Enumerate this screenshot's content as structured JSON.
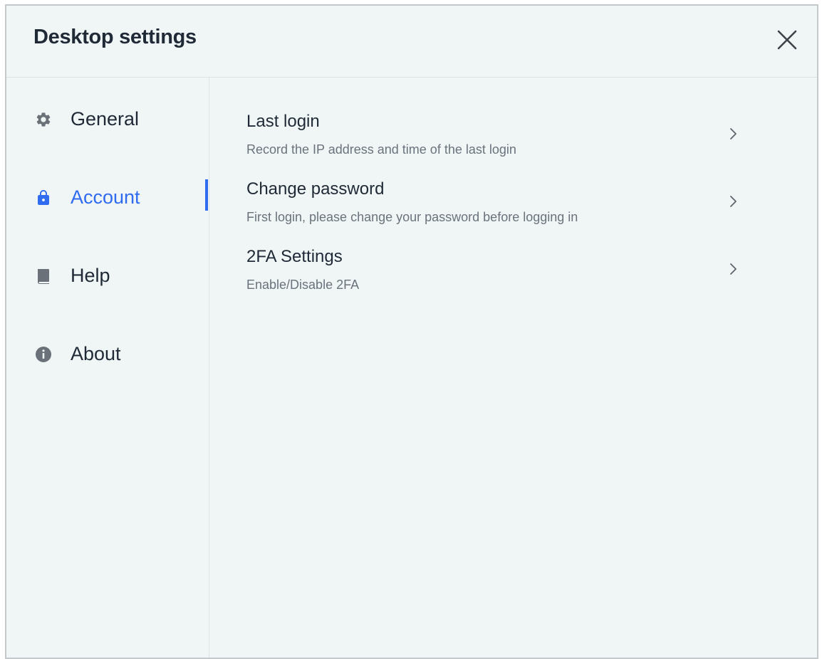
{
  "window": {
    "title": "Desktop settings"
  },
  "sidebar": {
    "items": [
      {
        "label": "General",
        "icon": "gear-icon",
        "active": false
      },
      {
        "label": "Account",
        "icon": "lock-icon",
        "active": true
      },
      {
        "label": "Help",
        "icon": "book-icon",
        "active": false
      },
      {
        "label": "About",
        "icon": "info-icon",
        "active": false
      }
    ]
  },
  "account": {
    "rows": [
      {
        "title": "Last login",
        "description": "Record the IP address and time of the last login"
      },
      {
        "title": "Change password",
        "description": "First login, please change your password before logging in"
      },
      {
        "title": "2FA Settings",
        "description": "Enable/Disable 2FA"
      }
    ]
  },
  "colors": {
    "accent": "#2f6cf0",
    "background": "#f0f5f6",
    "text": "#1f2a36",
    "muted_text": "#6a737c",
    "icon": "#6b7178"
  }
}
